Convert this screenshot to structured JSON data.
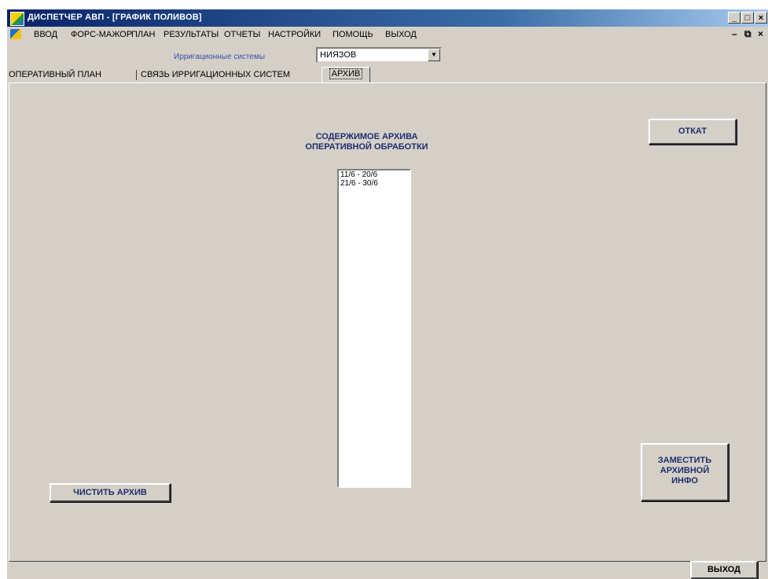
{
  "window": {
    "title": "ДИСПЕТЧЕР АВП - [ГРАФИК ПОЛИВОВ]",
    "caption_buttons": {
      "minimize": "_",
      "maximize": "□",
      "close": "×"
    }
  },
  "menu": {
    "items": [
      "ВВОД",
      "ФОРС-МАЖОР",
      "ПЛАН",
      "РЕЗУЛЬТАТЫ",
      "ОТЧЕТЫ",
      "НАСТРОЙКИ",
      "ПОМОЩЬ",
      "ВЫХОД"
    ],
    "mdi_buttons": {
      "minimize": "–",
      "restore": "⧉",
      "close": "×"
    }
  },
  "irrigation": {
    "label": "Ирригационные системы",
    "selected": "НИЯЗОВ"
  },
  "tabs": [
    {
      "label": "ОПЕРАТИВНЫЙ ПЛАН",
      "active": false
    },
    {
      "label": "СВЯЗЬ ИРРИГАЦИОННЫХ СИСТЕМ",
      "active": false
    },
    {
      "label": "АРХИВ",
      "active": true
    }
  ],
  "archive": {
    "title": "СОДЕРЖИМОЕ АРХИВА\nОПЕРАТИВНОЙ ОБРАБОТКИ",
    "items": [
      "11/6 - 20/6",
      "21/6 - 30/6"
    ]
  },
  "buttons": {
    "rollback": "ОТКАТ",
    "clear_archive": "ЧИСТИТЬ АРХИВ",
    "replace_archive": "ЗАМЕСТИТЬ\nАРХИВНОЙ\nИНФО",
    "exit": "ВЫХОД"
  },
  "colors": {
    "title_gradient_start": "#0a246a",
    "title_gradient_end": "#a6caf0",
    "face": "#d4d0c8",
    "button_text": "#1e2e6e",
    "label_blue": "#3a4fa8"
  }
}
